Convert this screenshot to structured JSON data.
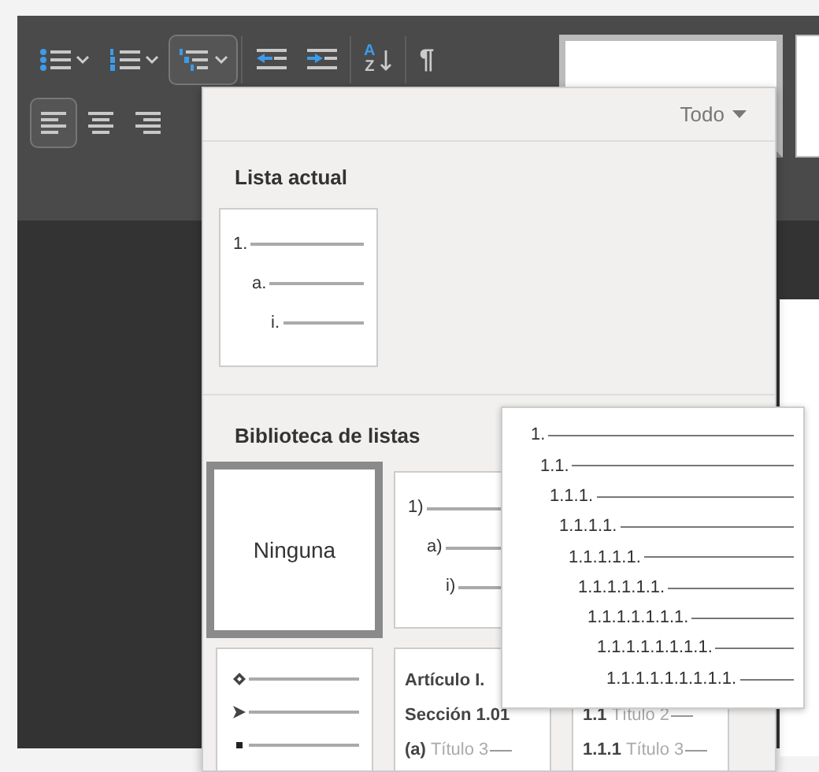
{
  "toolbar": {
    "buttons": [
      {
        "kind": "bullets",
        "selected": false,
        "dropdown": true
      },
      {
        "kind": "numbering",
        "selected": false,
        "dropdown": true
      },
      {
        "kind": "multilevel",
        "selected": true,
        "dropdown": true
      },
      {
        "kind": "outdent",
        "selected": false
      },
      {
        "kind": "indent",
        "selected": false
      },
      {
        "kind": "sort",
        "selected": false,
        "letters": [
          "A",
          "Z"
        ]
      },
      {
        "kind": "pilcrow",
        "selected": false,
        "glyph": "¶"
      }
    ],
    "alignment": [
      {
        "kind": "left",
        "selected": true
      },
      {
        "kind": "center",
        "selected": false
      },
      {
        "kind": "right",
        "selected": false
      }
    ]
  },
  "list_menu": {
    "filter": "Todo",
    "current_list": {
      "title": "Lista actual",
      "items": [
        {
          "kind": "levels",
          "markers": [
            "1.",
            "a.",
            "i."
          ]
        }
      ]
    },
    "library": {
      "title": "Biblioteca de listas",
      "rows": [
        [
          {
            "kind": "none",
            "label": "Ninguna",
            "selected": true
          },
          {
            "kind": "levels",
            "markers": [
              "1)",
              "a)",
              "i)"
            ],
            "selected": false
          }
        ],
        [
          {
            "kind": "bullets",
            "selected": false
          },
          {
            "kind": "headings",
            "selected": false,
            "lines": [
              {
                "number": "Artículo I."
              },
              {
                "number": "Sección 1.01"
              },
              {
                "number": "(a)",
                "title": "Título 3"
              }
            ]
          },
          {
            "kind": "headings",
            "selected": false,
            "lines": [
              {
                "number": "1.1",
                "title": "Título 2"
              },
              {
                "number": "1.1.1",
                "title": "Título 3"
              }
            ]
          }
        ]
      ]
    }
  },
  "tooltip": {
    "levels": [
      "1.",
      "1.1.",
      "1.1.1.",
      "1.1.1.1.",
      "1.1.1.1.1.",
      "1.1.1.1.1.1.",
      "1.1.1.1.1.1.1.",
      "1.1.1.1.1.1.1.1.",
      "1.1.1.1.1.1.1.1.1."
    ]
  }
}
